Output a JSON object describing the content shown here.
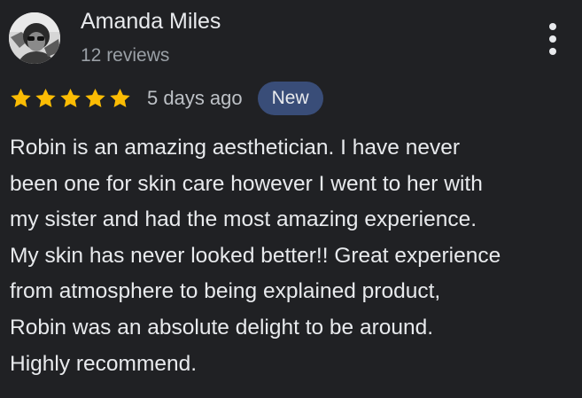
{
  "reviewer": {
    "name": "Amanda Miles",
    "review_count": "12 reviews",
    "avatar_icon": "profile-photo"
  },
  "rating": {
    "stars": 5,
    "max_stars": 5,
    "star_color": "#fbbc04",
    "date": "5 days ago",
    "badge": "New"
  },
  "review": {
    "lines": [
      "Robin is an amazing aesthetician. I have never",
      "been one for skin care however I went to her with",
      "my sister and had the most amazing experience.",
      "My skin has never looked better!! Great experience",
      "from atmosphere to being explained product,",
      "Robin was an absolute delight to be around.",
      "Highly recommend."
    ]
  },
  "menu": {
    "icon": "more-vert-icon"
  },
  "colors": {
    "background": "#202124",
    "text": "#e8eaed",
    "secondary_text": "#9aa0a6",
    "badge_background": "#394d78"
  }
}
